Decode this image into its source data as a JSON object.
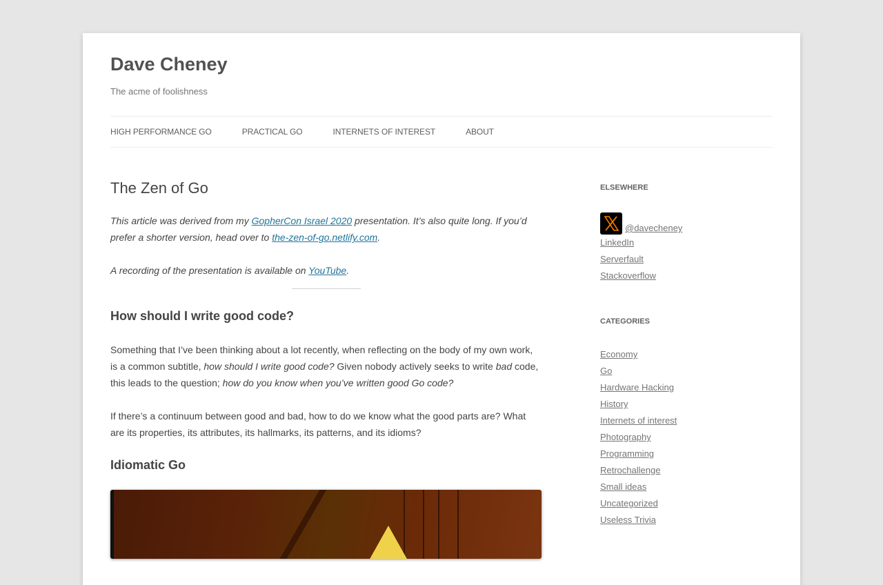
{
  "site": {
    "title": "Dave Cheney",
    "tagline": "The acme of foolishness"
  },
  "nav": {
    "items": [
      {
        "label": "High Performance Go"
      },
      {
        "label": "Practical Go"
      },
      {
        "label": "Internets of Interest"
      },
      {
        "label": "About"
      }
    ]
  },
  "article": {
    "title": "The Zen of Go",
    "intro": {
      "part1": "This article was derived from my ",
      "link1": "GopherCon Israel 2020",
      "part2": " presentation. It’s also quite long. If you’d prefer a shorter version, head over to ",
      "link2": "the-zen-of-go.netlify.com",
      "part3": "."
    },
    "recording": {
      "part1": "A recording of the presentation is available on ",
      "link": "YouTube",
      "part2": "."
    },
    "section1": {
      "heading": "How should I write good code?",
      "p1": {
        "a": "Something that I’ve been thinking about a lot recently, when reflecting on the body of my own work, is a common subtitle, ",
        "b": "how should I write good code?",
        "c": " Given nobody actively seeks to write ",
        "d": "bad",
        "e": " code, this leads to the question; ",
        "f": "how do you know when you’ve written good Go code?"
      },
      "p2": "If there’s a continuum between good and bad, how to do we know what the good parts are? What are its properties, its attributes, its hallmarks, its patterns, and its idioms?"
    },
    "section2": {
      "heading": "Idiomatic Go"
    }
  },
  "sidebar": {
    "elsewhere": {
      "title": "Elsewhere",
      "twitter_handle": " @davecheney",
      "links": [
        {
          "label": "LinkedIn"
        },
        {
          "label": "Serverfault"
        },
        {
          "label": "Stackoverflow"
        }
      ]
    },
    "categories": {
      "title": "Categories",
      "items": [
        {
          "label": "Economy"
        },
        {
          "label": "Go"
        },
        {
          "label": "Hardware Hacking"
        },
        {
          "label": "History"
        },
        {
          "label": "Internets of interest"
        },
        {
          "label": "Photography"
        },
        {
          "label": "Programming"
        },
        {
          "label": "Retrochallenge"
        },
        {
          "label": "Small ideas"
        },
        {
          "label": "Uncategorized"
        },
        {
          "label": "Useless Trivia"
        }
      ]
    }
  },
  "colors": {
    "link": "#21759b",
    "x_icon_accent": "#f57c00"
  }
}
